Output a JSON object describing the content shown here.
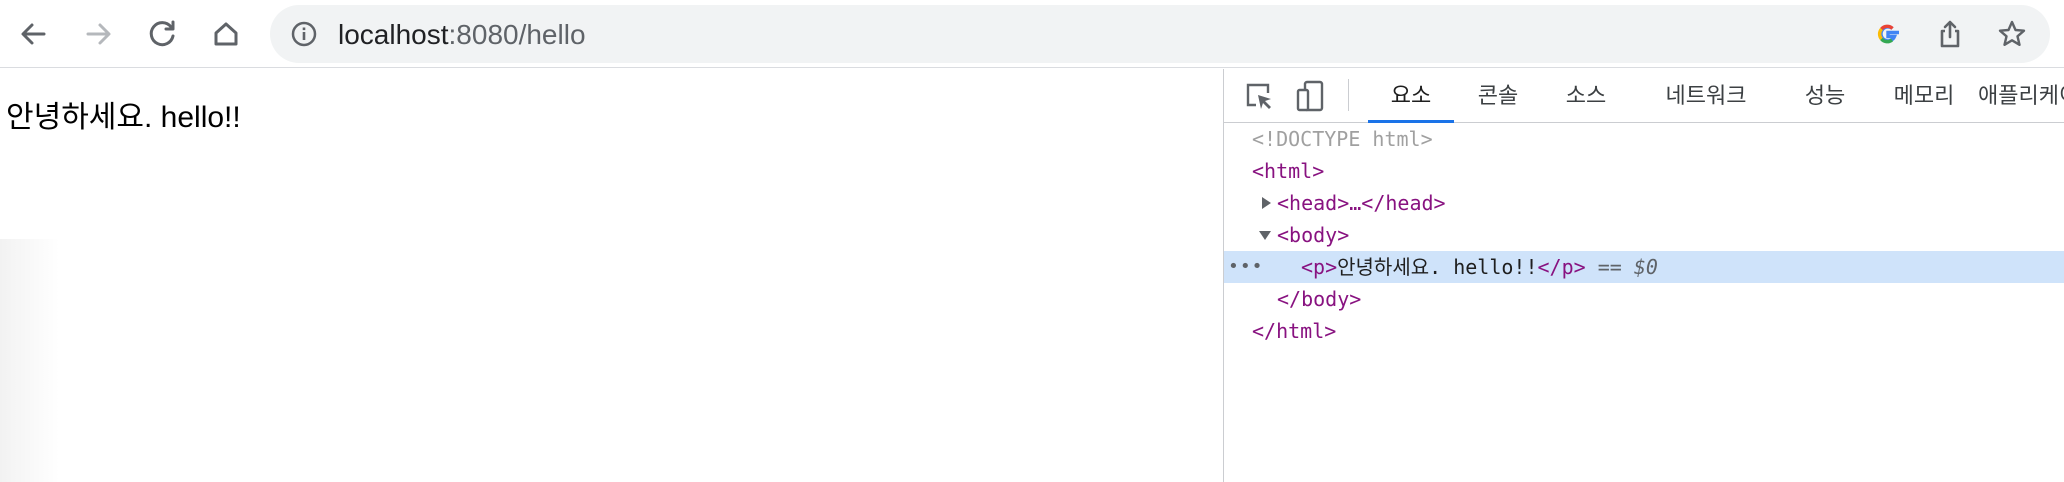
{
  "browser": {
    "url_host": "localhost",
    "url_rest": ":8080/hello",
    "icons": {
      "back": "back-arrow-icon",
      "forward": "forward-arrow-icon",
      "reload": "reload-icon",
      "home": "home-icon",
      "info": "site-info-icon",
      "google": "google-lens-icon",
      "share": "share-icon",
      "bookmark": "bookmark-star-icon"
    }
  },
  "page": {
    "text": "안녕하세요. hello!!"
  },
  "devtools": {
    "tabs": [
      {
        "label": "요소",
        "active": true
      },
      {
        "label": "콘솔"
      },
      {
        "label": "소스"
      },
      {
        "label": "네트워크"
      },
      {
        "label": "성능"
      },
      {
        "label": "메모리"
      },
      {
        "label": "애플리케이"
      }
    ],
    "tree": {
      "doctype": "<!DOCTYPE html>",
      "html_open": "<html>",
      "head": "<head>…</head>",
      "body_open": "<body>",
      "p_open": "<p>",
      "p_text": "안녕하세요. hello!!",
      "p_close": "</p>",
      "selected_marker": "== $0",
      "body_close": "</body>",
      "html_close": "</html>",
      "dots": "•••"
    },
    "colors": {
      "tag": "#881280",
      "selection": "#cfe3fa",
      "active_tab_underline": "#1a73e8"
    }
  }
}
